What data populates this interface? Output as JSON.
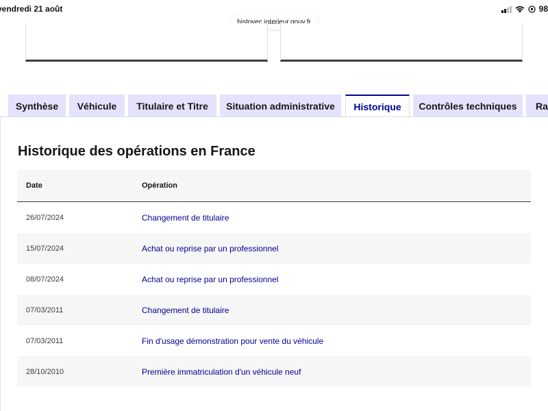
{
  "status_bar": {
    "date": "vendredi 21 août",
    "battery": "98"
  },
  "browser": {
    "url": "histovec.interieur.gouv.fr"
  },
  "tabs": [
    {
      "label": "Synthèse",
      "active": false
    },
    {
      "label": "Véhicule",
      "active": false
    },
    {
      "label": "Titulaire et Titre",
      "active": false
    },
    {
      "label": "Situation administrative",
      "active": false
    },
    {
      "label": "Historique",
      "active": true
    },
    {
      "label": "Contrôles techniques",
      "active": false
    },
    {
      "label": "Rap",
      "active": false
    }
  ],
  "section": {
    "title": "Historique des opérations en France"
  },
  "table": {
    "headers": {
      "date": "Date",
      "operation": "Opération"
    },
    "rows": [
      {
        "date": "26/07/2024",
        "operation": "Changement de titulaire"
      },
      {
        "date": "15/07/2024",
        "operation": "Achat ou reprise par un professionnel"
      },
      {
        "date": "08/07/2024",
        "operation": "Achat ou reprise par un professionnel"
      },
      {
        "date": "07/03/2011",
        "operation": "Changement de titulaire"
      },
      {
        "date": "07/03/2011",
        "operation": "Fin d'usage démonstration pour vente du véhicule"
      },
      {
        "date": "28/10/2010",
        "operation": "Première immatriculation d'un véhicule neuf"
      }
    ]
  },
  "colors": {
    "accent": "#000091",
    "tab_background": "#e3e3fd",
    "row_alt": "#f6f6f6"
  }
}
